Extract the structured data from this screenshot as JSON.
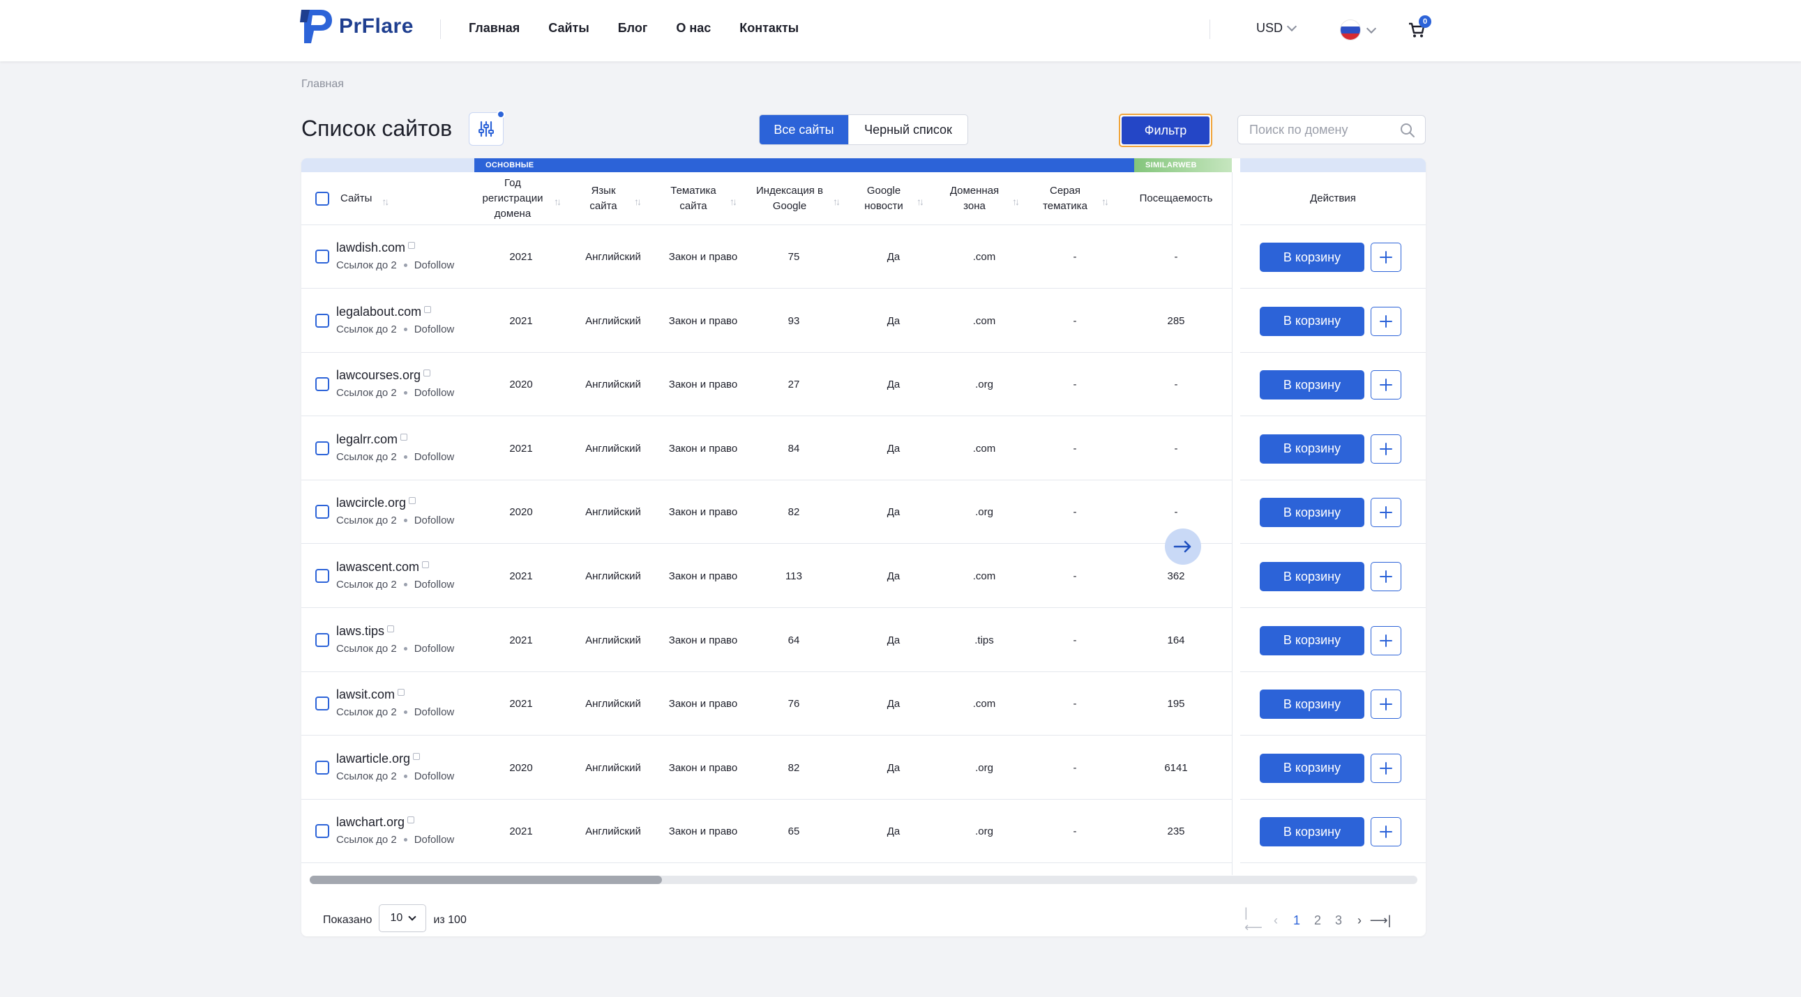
{
  "brand": {
    "name": "PrFlare"
  },
  "nav": [
    "Главная",
    "Сайты",
    "Блог",
    "О нас",
    "Контакты"
  ],
  "currency": "USD",
  "cart_count": "0",
  "breadcrumb": "Главная",
  "page_title": "Список сайтов",
  "tabs": {
    "all": "Все сайты",
    "blacklist": "Черный список"
  },
  "filter_label": "Фильтр",
  "search_placeholder": "Поиск по домену",
  "groups": {
    "main": "ОСНОВНЫЕ",
    "similarweb": "SIMILARWEB"
  },
  "columns": {
    "sites": "Сайты",
    "year": "Год регистрации домена",
    "lang": "Язык сайта",
    "topic": "Тематика сайта",
    "indexing": "Индексация в Google",
    "news": "Google новости",
    "zone": "Доменная зона",
    "grey": "Серая тематика",
    "visits": "Посещаемость",
    "actions": "Действия"
  },
  "cart_button_label": "В корзину",
  "rows": [
    {
      "site": "lawdish.com",
      "links": "Ссылок до 2",
      "follow": "Dofollow",
      "year": "2021",
      "lang": "Английский",
      "topic": "Закон и право",
      "indexing": "75",
      "news": "Да",
      "zone": ".com",
      "grey": "-",
      "visits": "-"
    },
    {
      "site": "legalabout.com",
      "links": "Ссылок до 2",
      "follow": "Dofollow",
      "year": "2021",
      "lang": "Английский",
      "topic": "Закон и право",
      "indexing": "93",
      "news": "Да",
      "zone": ".com",
      "grey": "-",
      "visits": "285"
    },
    {
      "site": "lawcourses.org",
      "links": "Ссылок до 2",
      "follow": "Dofollow",
      "year": "2020",
      "lang": "Английский",
      "topic": "Закон и право",
      "indexing": "27",
      "news": "Да",
      "zone": ".org",
      "grey": "-",
      "visits": "-"
    },
    {
      "site": "legalrr.com",
      "links": "Ссылок до 2",
      "follow": "Dofollow",
      "year": "2021",
      "lang": "Английский",
      "topic": "Закон и право",
      "indexing": "84",
      "news": "Да",
      "zone": ".com",
      "grey": "-",
      "visits": "-"
    },
    {
      "site": "lawcircle.org",
      "links": "Ссылок до 2",
      "follow": "Dofollow",
      "year": "2020",
      "lang": "Английский",
      "topic": "Закон и право",
      "indexing": "82",
      "news": "Да",
      "zone": ".org",
      "grey": "-",
      "visits": "-"
    },
    {
      "site": "lawascent.com",
      "links": "Ссылок до 2",
      "follow": "Dofollow",
      "year": "2021",
      "lang": "Английский",
      "topic": "Закон и право",
      "indexing": "113",
      "news": "Да",
      "zone": ".com",
      "grey": "-",
      "visits": "362"
    },
    {
      "site": "laws.tips",
      "links": "Ссылок до 2",
      "follow": "Dofollow",
      "year": "2021",
      "lang": "Английский",
      "topic": "Закон и право",
      "indexing": "64",
      "news": "Да",
      "zone": ".tips",
      "grey": "-",
      "visits": "164"
    },
    {
      "site": "lawsit.com",
      "links": "Ссылок до 2",
      "follow": "Dofollow",
      "year": "2021",
      "lang": "Английский",
      "topic": "Закон и право",
      "indexing": "76",
      "news": "Да",
      "zone": ".com",
      "grey": "-",
      "visits": "195"
    },
    {
      "site": "lawarticle.org",
      "links": "Ссылок до 2",
      "follow": "Dofollow",
      "year": "2020",
      "lang": "Английский",
      "topic": "Закон и право",
      "indexing": "82",
      "news": "Да",
      "zone": ".org",
      "grey": "-",
      "visits": "6141"
    },
    {
      "site": "lawchart.org",
      "links": "Ссылок до 2",
      "follow": "Dofollow",
      "year": "2021",
      "lang": "Английский",
      "topic": "Закон и право",
      "indexing": "65",
      "news": "Да",
      "zone": ".org",
      "grey": "-",
      "visits": "235"
    }
  ],
  "footer": {
    "shown_label": "Показано",
    "per_page": "10",
    "total_label": "из 100"
  },
  "pagination": {
    "pages": [
      "1",
      "2",
      "3"
    ],
    "current": "1"
  },
  "colors": {
    "primary": "#2c63d8",
    "filter": "#2446c6",
    "focus": "#f0a43a",
    "brand": "#1e3e8f"
  }
}
